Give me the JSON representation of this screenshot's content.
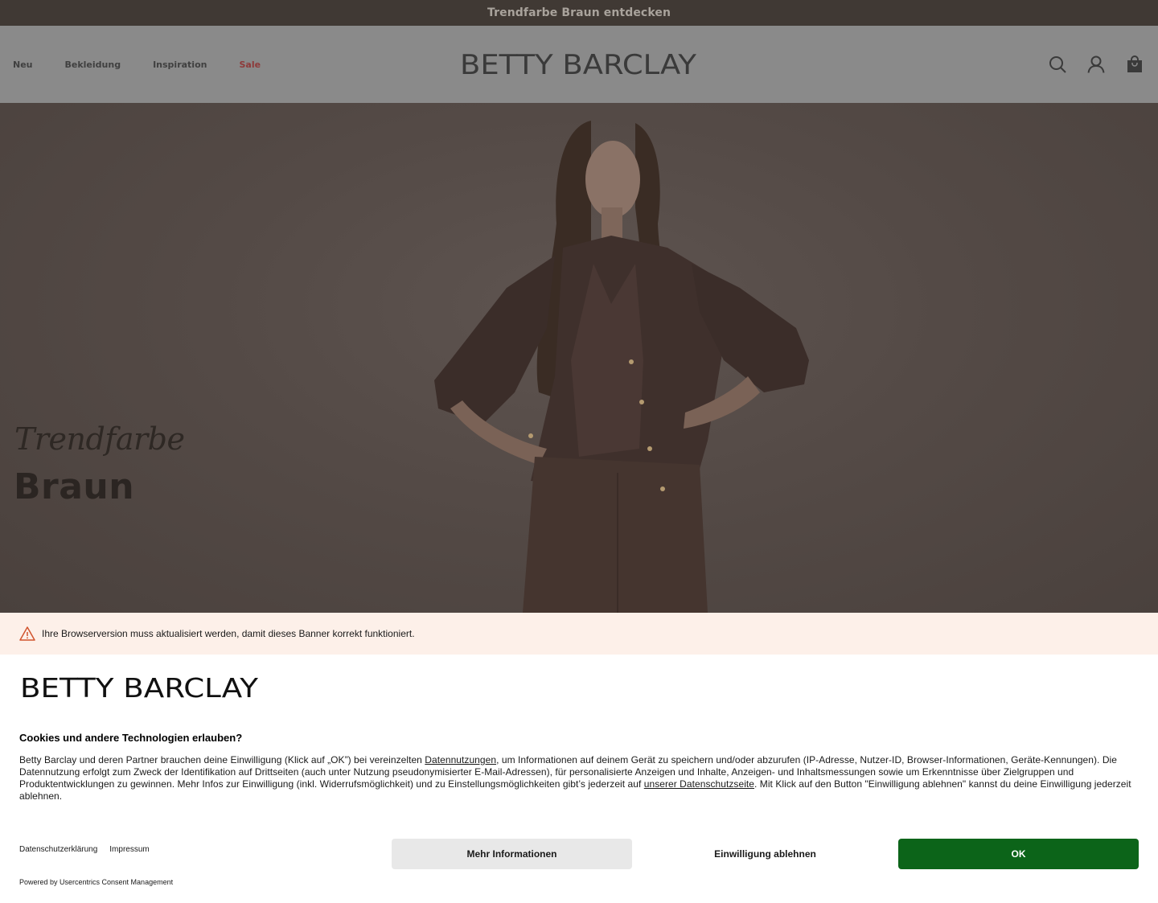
{
  "promo": {
    "text": "Trendfarbe Braun entdecken"
  },
  "nav": {
    "items": [
      {
        "label": "Neu"
      },
      {
        "label": "Bekleidung"
      },
      {
        "label": "Inspiration"
      },
      {
        "label": "Sale"
      }
    ]
  },
  "brand": {
    "name": "BETTY BARCLAY"
  },
  "header_icons": [
    "search-icon",
    "account-icon",
    "shopping-bag-icon"
  ],
  "hero": {
    "subtitle": "Trendfarbe",
    "title": "Braun"
  },
  "consent": {
    "warning": "Ihre Browserversion muss aktualisiert werden, damit dieses Banner korrekt funktioniert.",
    "title": "Cookies und andere Technologien erlauben?",
    "body_part1": "Betty Barclay und deren Partner brauchen deine Einwilligung (Klick auf „OK”) bei vereinzelten ",
    "link1": "Datennutzungen",
    "body_part2": ", um Informationen auf deinem Gerät zu speichern und/oder abzurufen (IP-Adresse, Nutzer-ID, Browser-Informationen, Geräte-Kennungen). Die Datennutzung erfolgt zum Zweck der Identifikation auf Drittseiten (auch unter Nutzung pseudonymisierter E-Mail-Adressen), für personalisierte Anzeigen und Inhalte, Anzeigen- und Inhaltsmessungen sowie um Erkenntnisse über Zielgruppen und Produktentwicklungen zu gewinnen. Mehr Infos zur Einwilligung (inkl. Widerrufsmöglichkeit) und zu Einstellungsmöglichkeiten gibt’s jederzeit auf ",
    "link2": "unserer Datenschutzseite",
    "body_part3": ". Mit Klick auf den Button \"Einwilligung ablehnen\" kannst du deine Einwilligung jederzeit ablehnen.",
    "footer_links": [
      "Datenschutzerklärung",
      "Impressum"
    ],
    "buttons": {
      "more": "Mehr Informationen",
      "deny": "Einwilligung ablehnen",
      "ok": "OK"
    },
    "powered_by": "Powered by Usercentrics Consent Management",
    "colors": {
      "ok_button": "#0c6419",
      "warning_bg": "#fdf0e9",
      "more_button": "#e8e8e8"
    }
  }
}
